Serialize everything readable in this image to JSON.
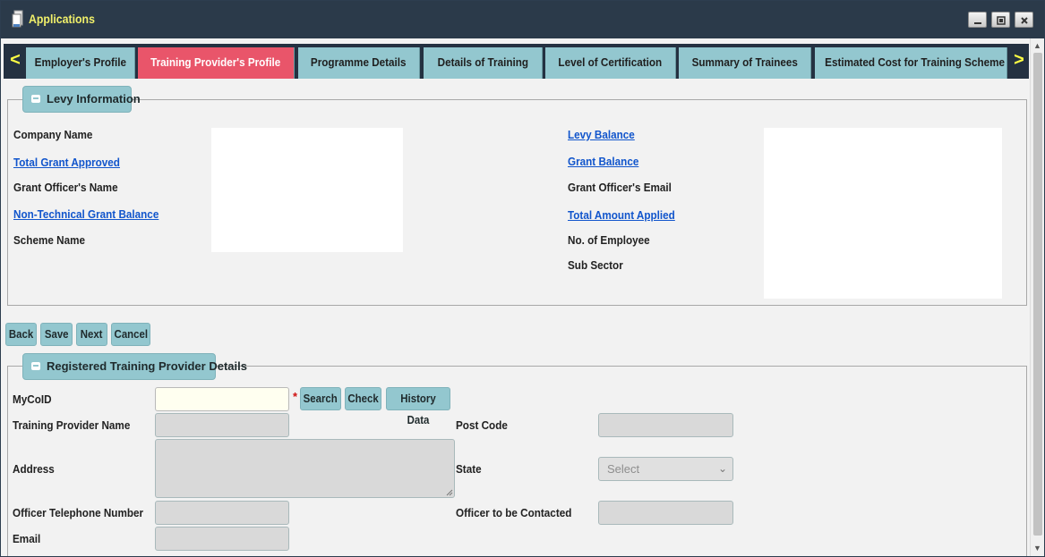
{
  "window": {
    "title": "Applications",
    "minimize_icon": "minimize-icon",
    "restore_icon": "restore-icon",
    "close_icon": "close-icon"
  },
  "tabs": [
    {
      "label": "Employer's Profile"
    },
    {
      "label": "Training Provider's Profile",
      "active": true
    },
    {
      "label": "Programme Details"
    },
    {
      "label": "Details of Training"
    },
    {
      "label": "Level of Certification"
    },
    {
      "label": "Summary of Trainees"
    },
    {
      "label": "Estimated Cost for Training Scheme"
    }
  ],
  "tab_nav": {
    "prev": "<",
    "next": ">"
  },
  "levy": {
    "heading": "Levy Information",
    "left": {
      "company_name": "Company Name",
      "total_grant_approved": "Total Grant Approved",
      "grant_officer_name": "Grant Officer's Name",
      "non_technical_grant_balance": "Non-Technical Grant Balance",
      "scheme_name": "Scheme Name"
    },
    "right": {
      "levy_balance": "Levy Balance",
      "grant_balance": "Grant Balance",
      "grant_officer_email": "Grant Officer's Email",
      "total_amount_applied": "Total Amount Applied",
      "no_of_employee": "No. of Employee",
      "sub_sector": "Sub Sector"
    }
  },
  "actions": {
    "back": "Back",
    "save": "Save",
    "next": "Next",
    "cancel": "Cancel"
  },
  "provider": {
    "heading": "Registered Training Provider Details",
    "mycoid_label": "MyCoID",
    "required_mark": "*",
    "search": "Search",
    "check": "Check",
    "history": "History Data",
    "name_label": "Training Provider Name",
    "postcode_label": "Post Code",
    "address_label": "Address",
    "state_label": "State",
    "state_selected": "Select",
    "phone_label": "Officer Telephone Number",
    "officer_label": "Officer to be Contacted",
    "email_label": "Email"
  },
  "colors": {
    "titlebar": "#2b3a4a",
    "title_text": "#f1f06a",
    "tab": "#93c7cf",
    "tab_active": "#e9556a",
    "link": "#1155cc"
  }
}
